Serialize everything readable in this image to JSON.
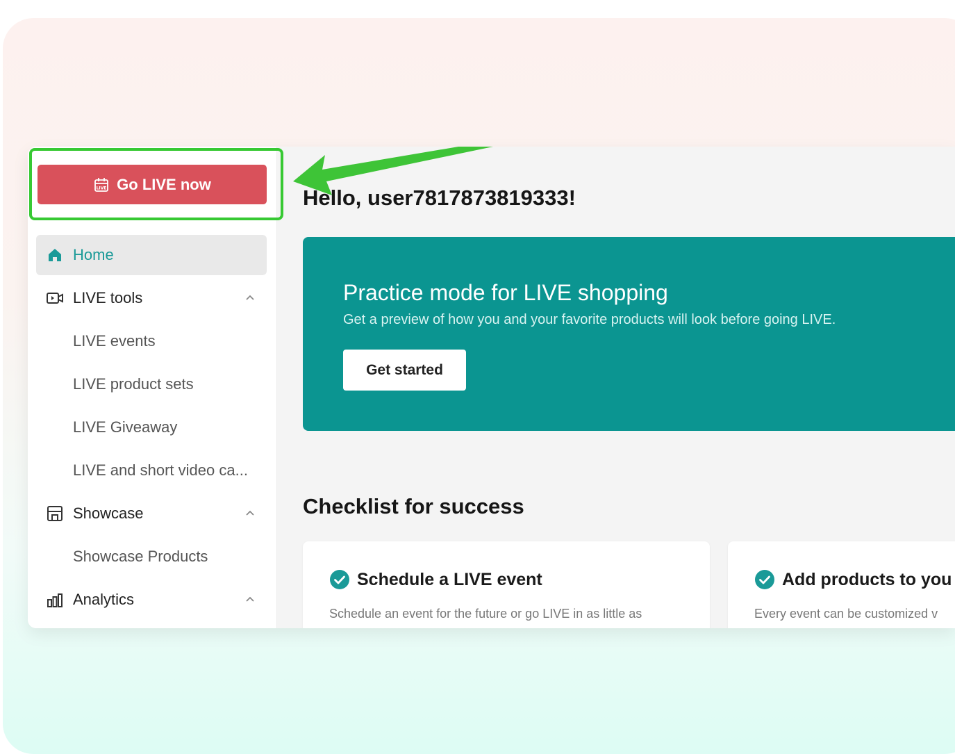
{
  "sidebar": {
    "go_live_label": "Go LIVE now",
    "items": [
      {
        "label": "Home",
        "icon": "home-icon",
        "active": true
      },
      {
        "label": "LIVE tools",
        "icon": "live-camera-icon",
        "expanded": true
      },
      {
        "label": "LIVE events",
        "sub": true
      },
      {
        "label": "LIVE product sets",
        "sub": true
      },
      {
        "label": "LIVE Giveaway",
        "sub": true
      },
      {
        "label": "LIVE and short video ca...",
        "sub": true
      },
      {
        "label": "Showcase",
        "icon": "store-icon",
        "expanded": true
      },
      {
        "label": "Showcase Products",
        "sub": true
      },
      {
        "label": "Analytics",
        "icon": "analytics-icon",
        "expanded": true
      }
    ]
  },
  "main": {
    "greeting": "Hello, user7817873819333!",
    "banner": {
      "title": "Practice mode for LIVE shopping",
      "subtitle": "Get a preview of how you and your favorite products will look before going LIVE.",
      "button_label": "Get started"
    },
    "checklist": {
      "title": "Checklist for success",
      "cards": [
        {
          "title": "Schedule a LIVE event",
          "description": "Schedule an event for the future or go LIVE in as little as"
        },
        {
          "title": "Add products to you",
          "description": "Every event can be customized v"
        }
      ]
    }
  },
  "colors": {
    "accent_teal": "#0b9591",
    "go_live_red": "#d9515b",
    "highlight_green": "#37c933"
  }
}
